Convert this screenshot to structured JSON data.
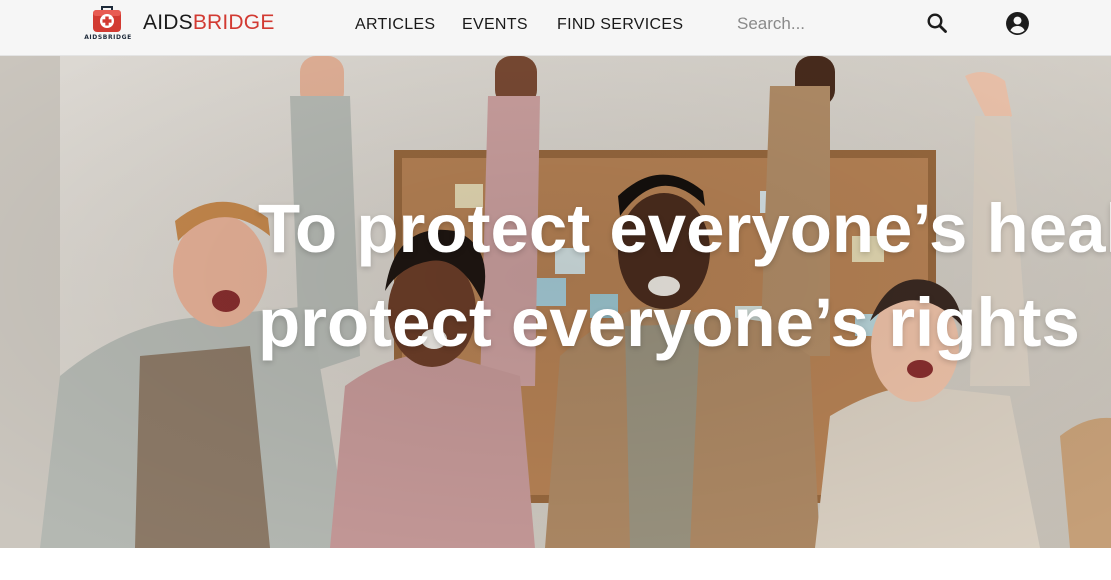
{
  "header": {
    "logo": {
      "icon": "first-aid-kit-icon",
      "caption": "AIDSBRIDGE",
      "colors": {
        "case": "#d23a32",
        "cross": "#ffffff",
        "handle": "#1e2a3a"
      }
    },
    "brand": {
      "part1": "AIDS",
      "part2": "BRIDGE",
      "part1_color": "#1a1a1a",
      "part2_color": "#d23a32"
    },
    "nav": [
      {
        "label": "ARTICLES"
      },
      {
        "label": "EVENTS"
      },
      {
        "label": "FIND SERVICES"
      }
    ],
    "search": {
      "placeholder": "Search...",
      "value": "",
      "icon": "search-icon"
    },
    "account": {
      "icon": "account-circle-icon"
    },
    "background": "#f6f6f6"
  },
  "hero": {
    "headline_line1": "To protect everyone’s health,",
    "headline_line2": "protect everyone’s rights",
    "headline_color": "#ffffff",
    "image": "photo-of-four-cheering-people-raising-arms"
  }
}
